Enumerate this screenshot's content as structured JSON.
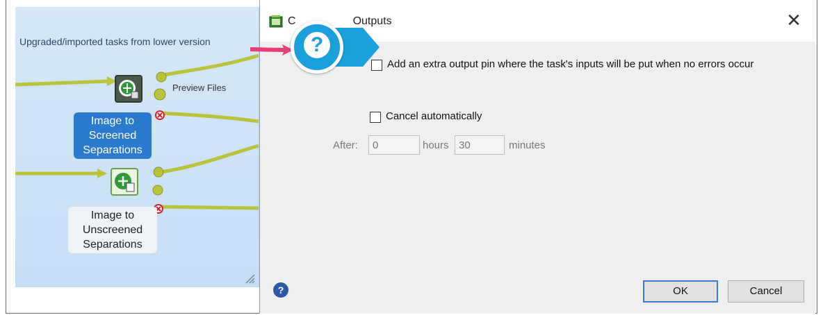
{
  "canvas": {
    "title": "Upgraded/imported tasks from lower version",
    "tasks": [
      {
        "label": "Image to Screened Separations",
        "pin_label": "Preview Files",
        "selected": true
      },
      {
        "label": "Image to Unscreened Separations",
        "selected": false
      }
    ]
  },
  "dialog": {
    "title": "Configure Outputs",
    "title_visible_prefix": "C",
    "title_visible_suffix": "Outputs",
    "options": {
      "extra_output_pin_label": "Add an extra output pin where the task's inputs will be put when no errors occur",
      "extra_output_pin_checked": false,
      "cancel_auto_label": "Cancel automatically",
      "cancel_auto_checked": false
    },
    "after_label": "After:",
    "hours_value": "0",
    "hours_label": "hours",
    "minutes_value": "30",
    "minutes_label": "minutes",
    "ok_label": "OK",
    "cancel_label": "Cancel",
    "close_glyph": "✕",
    "help_glyph": "?"
  },
  "callout": {
    "glyph": "?"
  },
  "colors": {
    "flow_line": "#b9c43c",
    "selected_task": "#2a7bd0",
    "callout": "#1aa1dc",
    "callout_arrow": "#e6407a"
  }
}
